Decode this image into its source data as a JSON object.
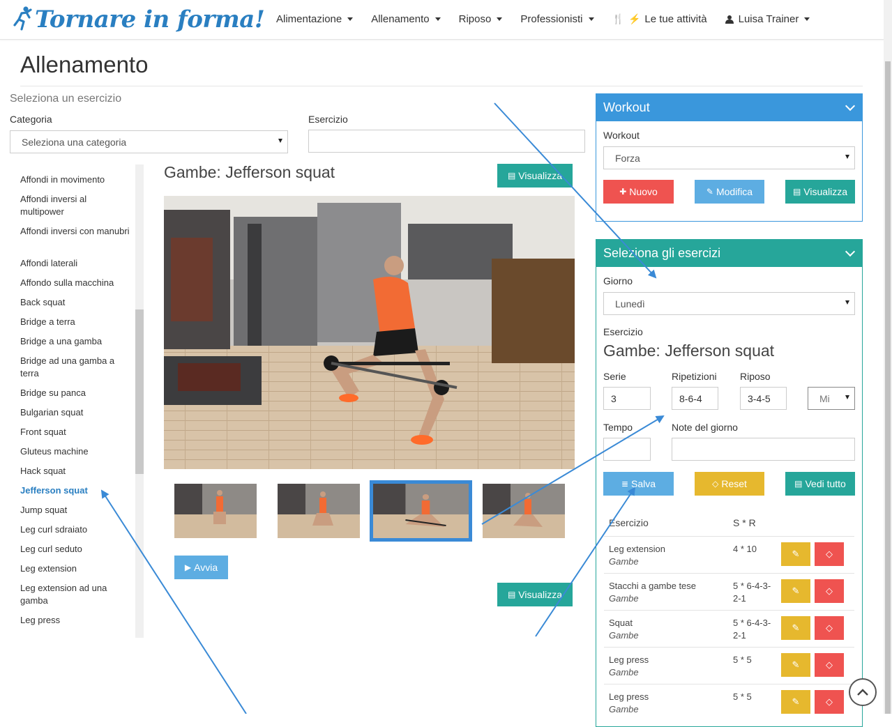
{
  "brand": {
    "logo_text": "Tornare in forma!"
  },
  "nav": {
    "items": [
      {
        "label": "Alimentazione"
      },
      {
        "label": "Allenamento"
      },
      {
        "label": "Riposo"
      },
      {
        "label": "Professionisti"
      }
    ],
    "activities_label": "Le tue attività",
    "user_label": "Luisa Trainer"
  },
  "page": {
    "title": "Allenamento",
    "select_caption": "Seleziona un esercizio",
    "category_label": "Categoria",
    "category_value": "Seleziona una categoria",
    "exercise_label": "Esercizio",
    "exercise_value": ""
  },
  "exercise_list": [
    {
      "label": "Affondi in movimento"
    },
    {
      "label": "Affondi inversi al multipower"
    },
    {
      "label": "Affondi inversi con manubri"
    },
    {
      "label": "Affondi laterali"
    },
    {
      "label": "Affondo sulla macchina"
    },
    {
      "label": "Back squat"
    },
    {
      "label": "Bridge a terra"
    },
    {
      "label": "Bridge a una gamba"
    },
    {
      "label": "Bridge ad una gamba a terra"
    },
    {
      "label": "Bridge su panca"
    },
    {
      "label": "Bulgarian squat"
    },
    {
      "label": "Front squat"
    },
    {
      "label": "Gluteus machine"
    },
    {
      "label": "Hack squat"
    },
    {
      "label": "Jefferson squat",
      "active": true
    },
    {
      "label": "Jump squat"
    },
    {
      "label": "Leg curl sdraiato"
    },
    {
      "label": "Leg curl seduto"
    },
    {
      "label": "Leg extension"
    },
    {
      "label": "Leg extension ad una gamba"
    },
    {
      "label": "Leg press"
    }
  ],
  "detail": {
    "title": "Gambe: Jefferson squat",
    "view_label": "Visualizza",
    "play_label": "Avvia",
    "view_bottom_label": "Visualizza",
    "selected_thumb": 3
  },
  "workout_panel": {
    "header": "Workout",
    "workout_label": "Workout",
    "workout_value": "Forza",
    "new_label": "Nuovo",
    "edit_label": "Modifica",
    "view_label": "Visualizza"
  },
  "select_panel": {
    "header": "Seleziona gli esercizi",
    "day_label": "Giorno",
    "day_value": "Lunedì",
    "exercise_label": "Esercizio",
    "exercise_value": "Gambe: Jefferson squat",
    "series_label": "Serie",
    "series_value": "3",
    "reps_label": "Ripetizioni",
    "reps_value": "8-6-4",
    "rest_label": "Riposo",
    "rest_value": "3-4-5",
    "rest_unit": "Mi",
    "time_label": "Tempo",
    "time_value": "",
    "notes_label": "Note del giorno",
    "notes_value": "",
    "save_label": "Salva",
    "reset_label": "Reset",
    "view_all_label": "Vedi tutto",
    "table_header_exercise": "Esercizio",
    "table_header_sr": "S * R",
    "rows": [
      {
        "name": "Leg extension",
        "category": "Gambe",
        "sr": "4 * 10"
      },
      {
        "name": "Stacchi a gambe tese",
        "category": "Gambe",
        "sr": "5 * 6-4-3-2-1"
      },
      {
        "name": "Squat",
        "category": "Gambe",
        "sr": "5 * 6-4-3-2-1"
      },
      {
        "name": "Leg press",
        "category": "Gambe",
        "sr": "5 * 5"
      },
      {
        "name": "Leg press",
        "category": "Gambe",
        "sr": "5 * 5"
      }
    ]
  },
  "colors": {
    "brand_blue": "#2a7fc1",
    "panel_blue": "#3a97dc",
    "teal": "#26a69a",
    "red": "#ef5350",
    "light_blue": "#5dade2",
    "gold": "#e6b82e",
    "annotation_arrow": "#3a8ad6"
  }
}
